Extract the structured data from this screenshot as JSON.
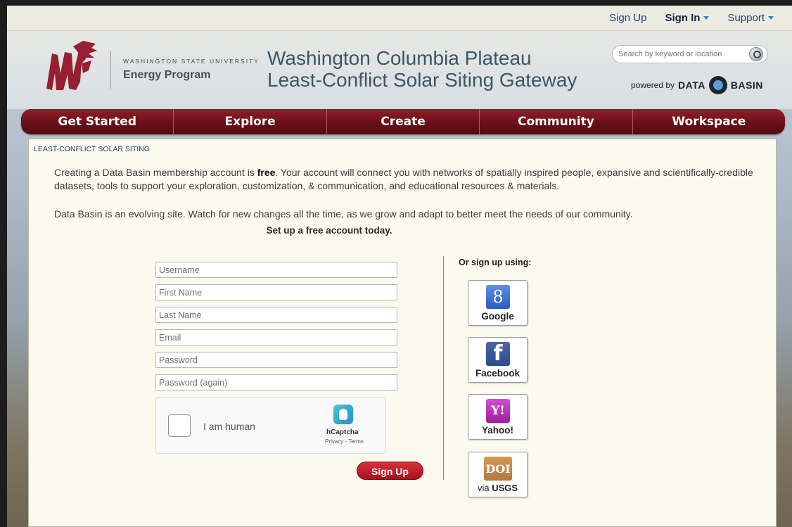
{
  "topbar": {
    "sign_up": "Sign Up",
    "sign_in": "Sign In",
    "support": "Support"
  },
  "header": {
    "university": "WASHINGTON STATE UNIVERSITY",
    "program": "Energy Program",
    "title_line1": "Washington Columbia Plateau",
    "title_line2": "Least-Conflict Solar Siting Gateway",
    "search_placeholder": "Search by keyword or location",
    "powered_by": "powered by",
    "brand_left": "DATA",
    "brand_right": "BASIN"
  },
  "nav": {
    "items": [
      "Get Started",
      "Explore",
      "Create",
      "Community",
      "Workspace"
    ]
  },
  "content": {
    "breadcrumb": "LEAST-CONFLICT SOLAR SITING",
    "intro_before": "Creating a Data Basin membership account is ",
    "intro_bold": "free",
    "intro_after": ". Your account will connect you with networks of spatially inspired people, expansive and scientifically-credible datasets, tools to support your exploration, customization, & communication, and educational resources & materials.",
    "note": "Data Basin is an evolving site. Watch for new changes all the time, as we grow and adapt to better meet the needs of our community.",
    "cta": "Set up a free account today."
  },
  "form": {
    "username": "Username",
    "first_name": "First Name",
    "last_name": "Last Name",
    "email": "Email",
    "password": "Password",
    "password_again": "Password (again)",
    "captcha_label": "I am human",
    "captcha_brand": "hCaptcha",
    "captcha_links": "Privacy - Terms",
    "submit": "Sign Up"
  },
  "social": {
    "heading": "Or sign up using:",
    "google_glyph": "8",
    "google": "Google",
    "facebook_glyph": "f",
    "facebook": "Facebook",
    "yahoo_glyph": "Y!",
    "yahoo": "Yahoo!",
    "doi_glyph": "DOI",
    "doi_via": "via",
    "doi_usgs": "USGS"
  },
  "colors": {
    "nav_crimson": "#6a1019",
    "button_red": "#c11f29",
    "link_blue": "#1a3f86",
    "title_slate": "#3d5566"
  }
}
